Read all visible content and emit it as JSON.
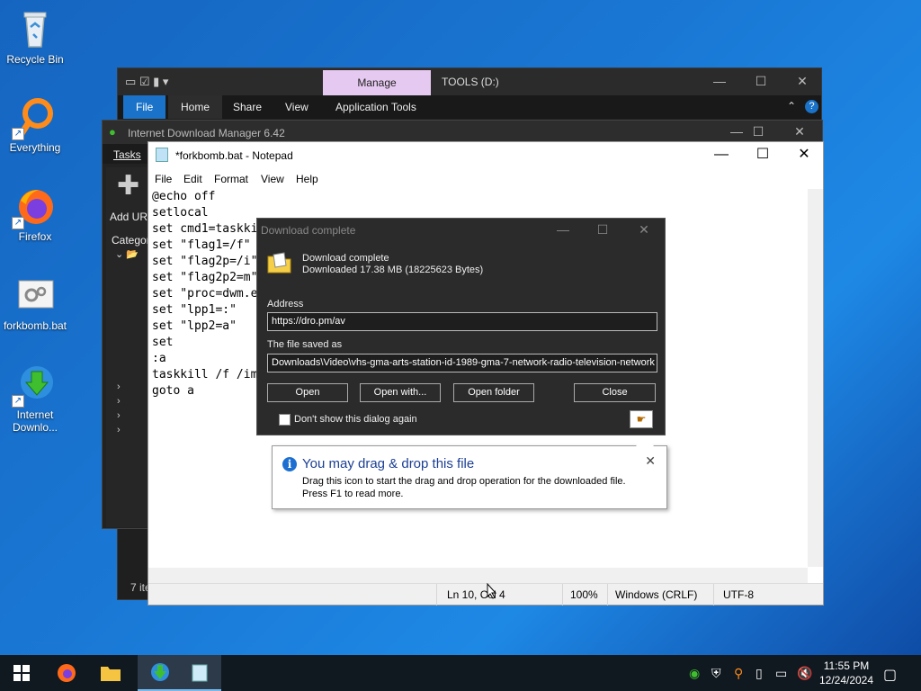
{
  "desktop": {
    "icons": [
      {
        "label": "Recycle Bin"
      },
      {
        "label": "Everything"
      },
      {
        "label": "Firefox"
      },
      {
        "label": "forkbomb.bat"
      },
      {
        "label": "Internet Downlo..."
      }
    ]
  },
  "explorer": {
    "manage_tab": "Manage",
    "title": "TOOLS (D:)",
    "ribbon": {
      "file": "File",
      "home": "Home",
      "share": "Share",
      "view": "View",
      "app_tools": "Application Tools"
    },
    "status": "7 ite"
  },
  "idm": {
    "title": "Internet Download Manager 6.42",
    "menu_tasks": "Tasks",
    "add_url": "Add UR",
    "categories": "Categor"
  },
  "notepad": {
    "title": "*forkbomb.bat - Notepad",
    "menu": {
      "file": "File",
      "edit": "Edit",
      "format": "Format",
      "view": "View",
      "help": "Help"
    },
    "lines": [
      "@echo off",
      "setlocal",
      "set cmd1=taskki",
      "set \"flag1=/f\"",
      "set \"flag2p=/i\"",
      "set \"flag2p2=m\"",
      "set \"proc=dwm.e",
      "set \"lpp1=:\"",
      "set \"lpp2=a\"",
      "set",
      ":a",
      "taskkill /f /im",
      "goto a"
    ],
    "status": {
      "position": "Ln 10, Col 4",
      "zoom": "100%",
      "eol": "Windows (CRLF)",
      "encoding": "UTF-8"
    }
  },
  "dialog": {
    "title": "Download complete",
    "heading": "Download complete",
    "downloaded": "Downloaded 17.38  MB (18225623 Bytes)",
    "address_label": "Address",
    "address_value": "https://dro.pm/av",
    "saved_label": "The file saved as",
    "saved_value": "Downloads\\Video\\vhs-gma-arts-station-id-1989-gma-7-network-radio-television-network",
    "buttons": {
      "open": "Open",
      "open_with": "Open with...",
      "open_folder": "Open folder",
      "close": "Close"
    },
    "checkbox_label": "Don't show this dialog again"
  },
  "tooltip": {
    "title": "You may drag & drop this file",
    "line1": "Drag this icon to start the drag and drop operation for the downloaded file.",
    "line2": "Press F1 to read more."
  },
  "taskbar": {
    "time": "11:55 PM",
    "date": "12/24/2024"
  },
  "colors": {
    "accent": "#1a73c8",
    "manage_tab": "#e6c9f0",
    "tooltip_title": "#1c3f94"
  }
}
